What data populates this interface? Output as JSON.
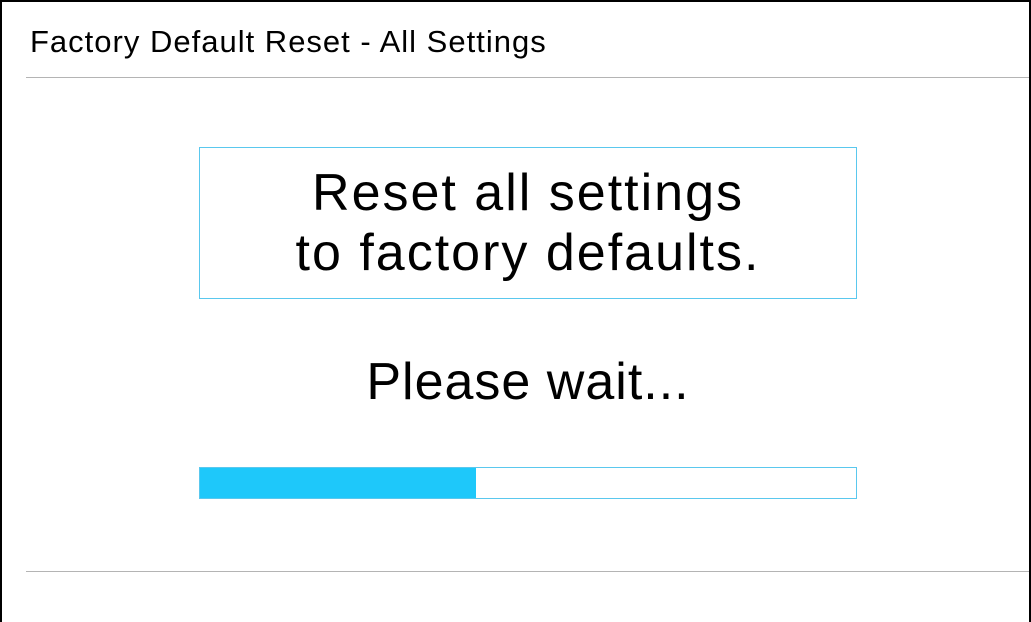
{
  "header": {
    "title": "Factory Default Reset - All Settings"
  },
  "message": {
    "line1": "Reset all settings",
    "line2": "to factory defaults."
  },
  "status": {
    "text": "Please wait..."
  },
  "progress": {
    "fraction": 0.42
  },
  "colors": {
    "accent": "#1ec8fa",
    "accent_border": "#5ac8ee",
    "divider": "#b4b4b4"
  }
}
